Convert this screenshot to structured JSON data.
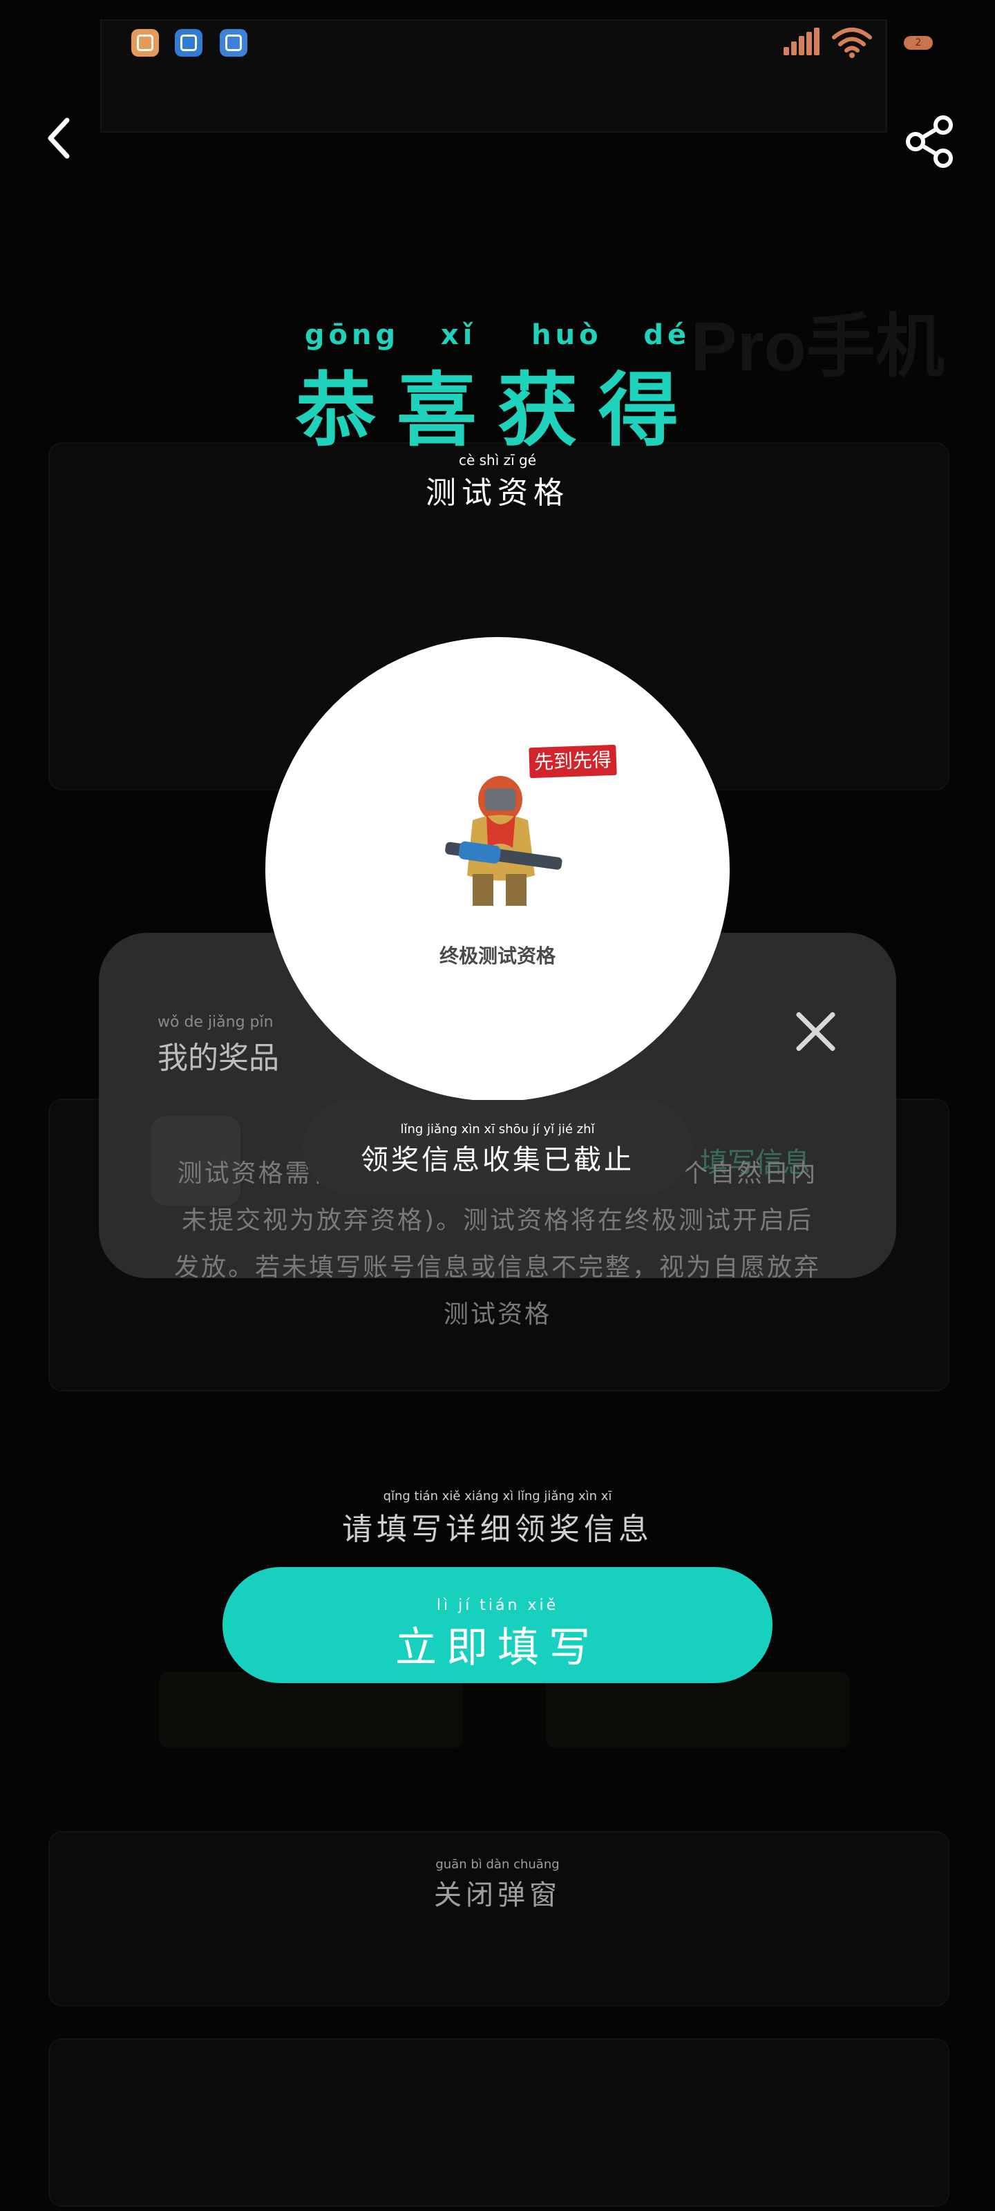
{
  "status_bar": {
    "app_icons": [
      "shopping-basket-icon",
      "storage-icon",
      "tools-icon"
    ],
    "battery_level": "2",
    "signal": "signal-icon",
    "wifi": "wifi-icon"
  },
  "header": {
    "back_icon": "chevron-left-icon",
    "share_icon": "share-icon"
  },
  "background_page": {
    "title_fragment": "Pro手机"
  },
  "popup": {
    "title": "恭喜获得",
    "title_pinyin": "gōng   xǐ    huò   dé",
    "subtitle": "测试资格",
    "subtitle_pinyin": "cè shì zī gé",
    "prize": {
      "badge": "先到先得",
      "name": "终极测试资格"
    },
    "notice": "领奖信息收集已截止",
    "notice_pinyin": "lǐng jiǎng xìn xī shōu jí yǐ jié zhǐ",
    "description": "测试资格需在7个自然日内填写领奖信息(7个自然日内未提交视为放弃资格)。测试资格将在终极测试开启后发放。若未填写账号信息或信息不完整，视为自愿放弃测试资格",
    "fill_prompt": "请填写详细领奖信息",
    "fill_prompt_pinyin": "qǐng tián xiě xiáng xì lǐng jiǎng xìn xī",
    "fill_button": "立即填写",
    "fill_button_pinyin": "lì jí tián xiě",
    "close_label": "关闭弹窗",
    "close_pinyin": "guān bì dàn chuāng"
  },
  "my_prizes_sheet": {
    "title": "我的奖品",
    "title_pinyin": "wǒ de jiǎng pǐn",
    "link": "填写信息"
  },
  "colors": {
    "accent": "#1ed2bb",
    "button": "#18d0be",
    "badge": "#d3232b"
  }
}
